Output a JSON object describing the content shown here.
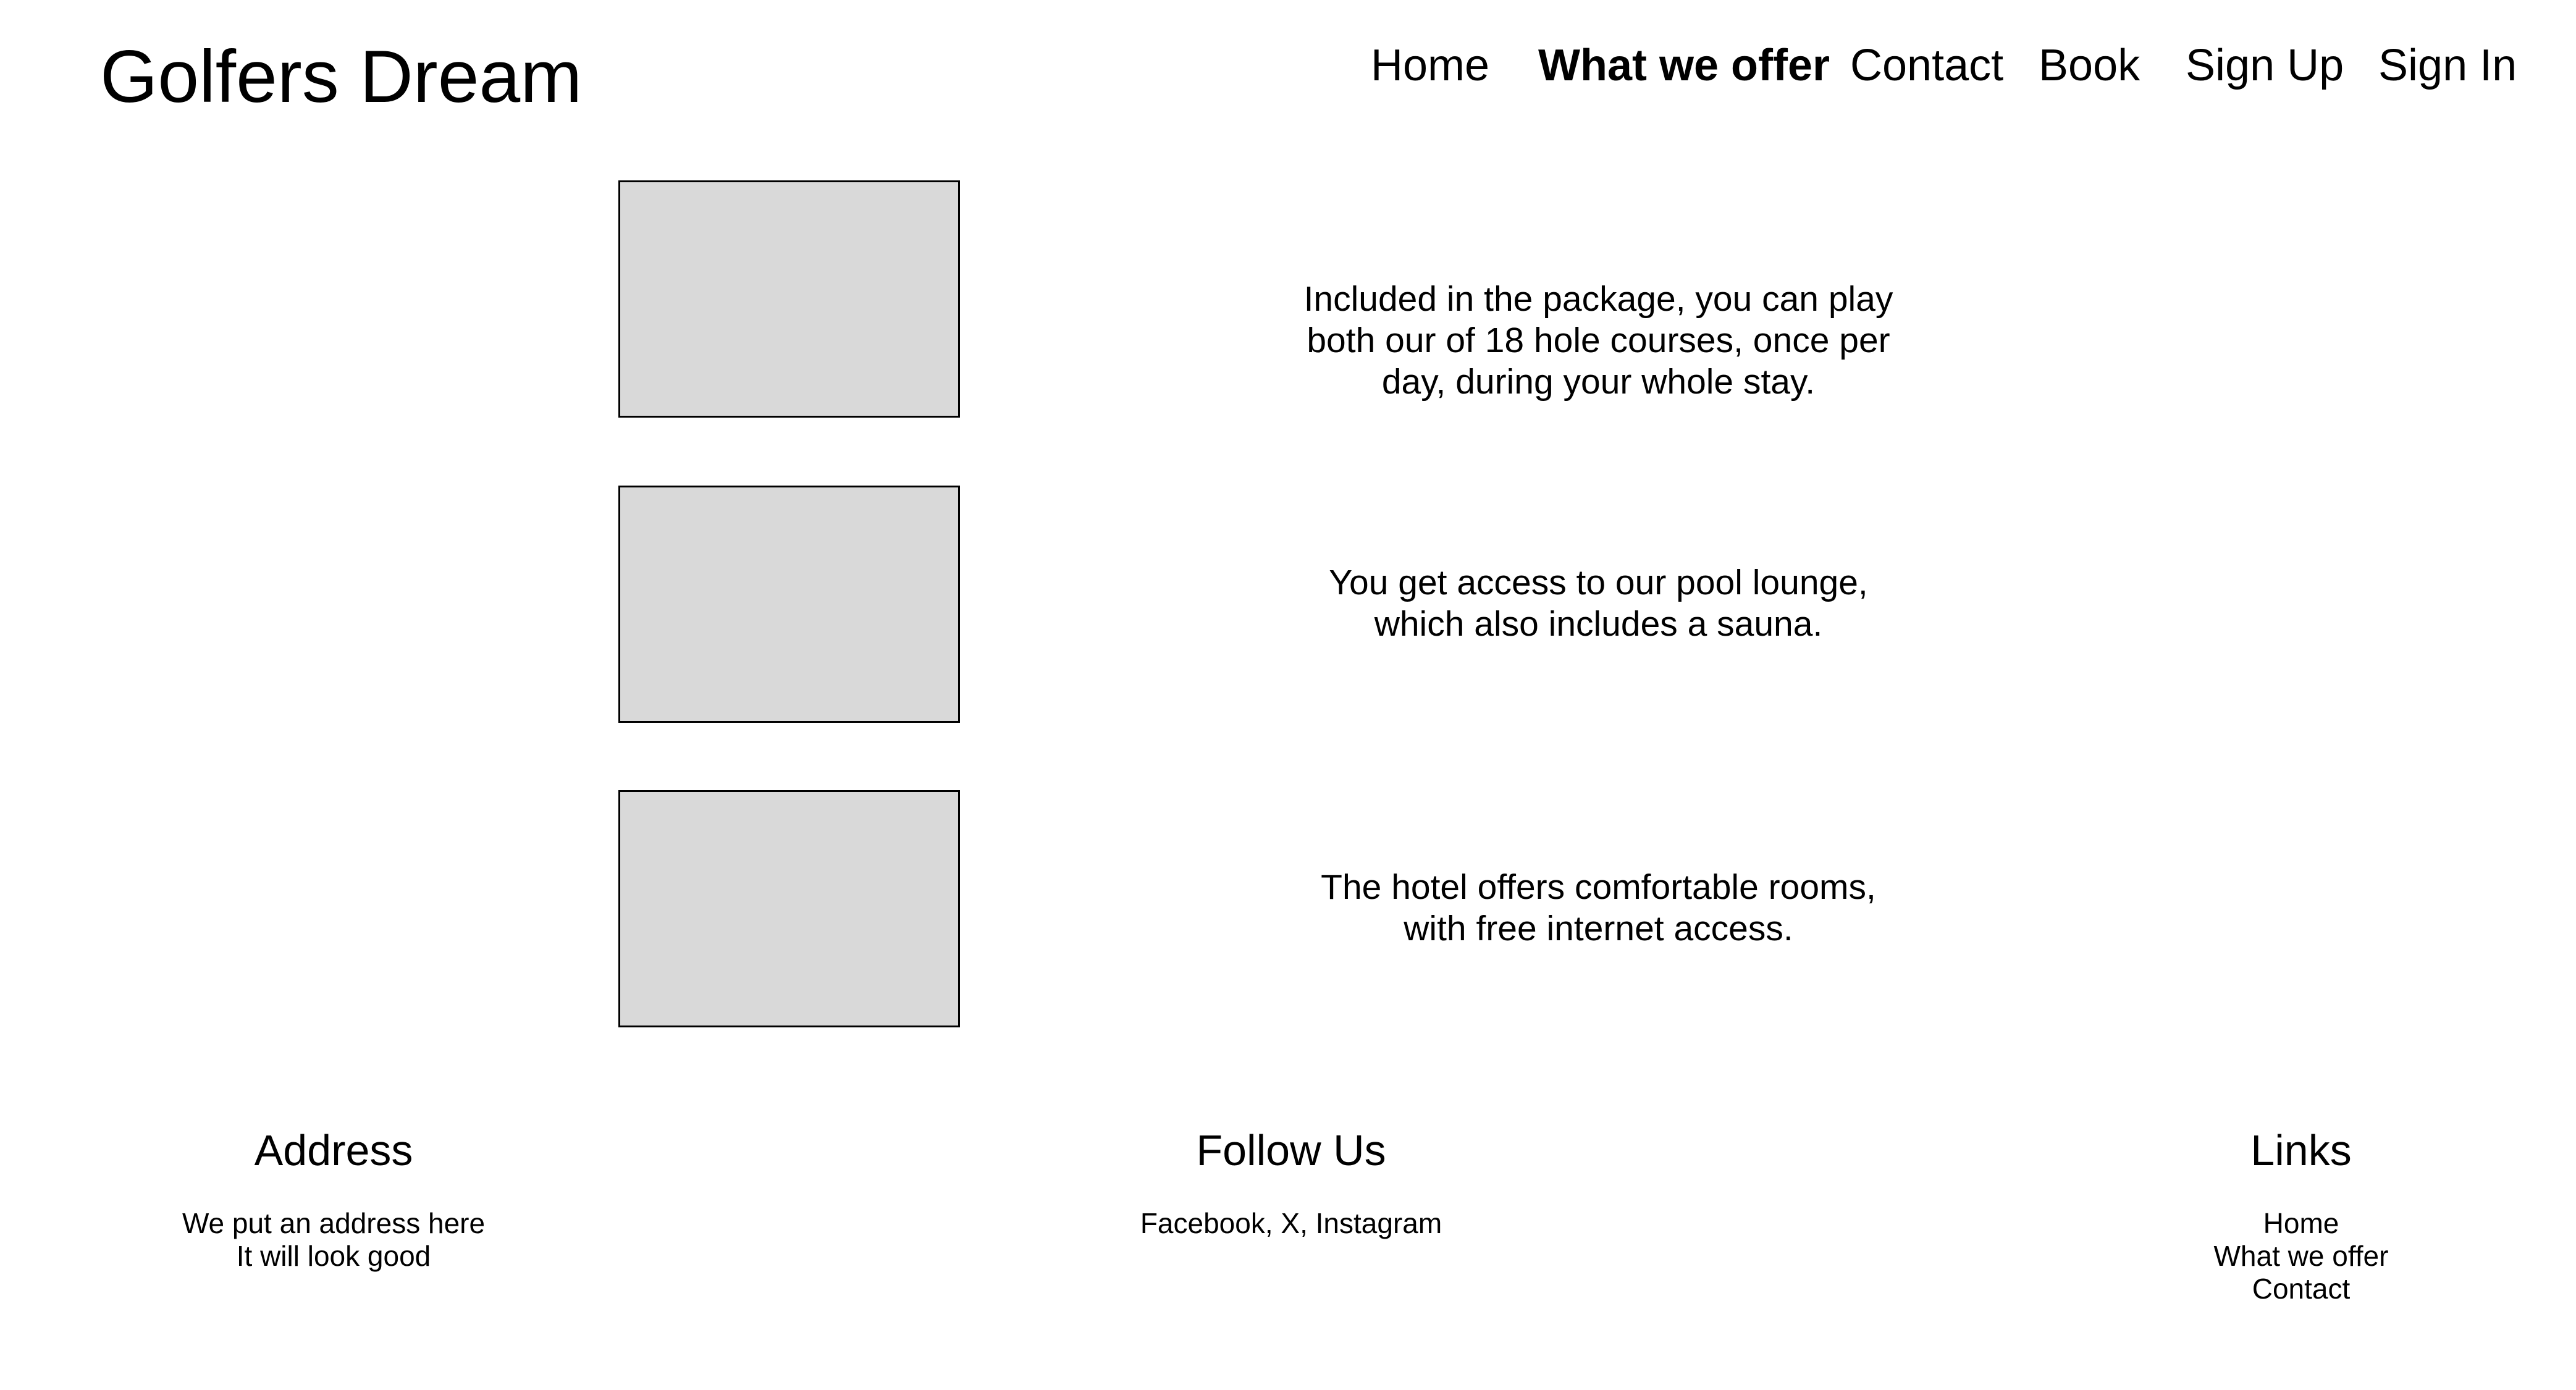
{
  "header": {
    "brand": "Golfers Dream",
    "nav": [
      {
        "label": "Home",
        "active": false
      },
      {
        "label": "What we offer",
        "active": true
      },
      {
        "label": "Contact",
        "active": false
      },
      {
        "label": "Book",
        "active": false
      },
      {
        "label": "Sign Up",
        "active": false
      },
      {
        "label": "Sign In",
        "active": false
      }
    ]
  },
  "offers": [
    {
      "text": "Included in the package, you can play\nboth our of 18 hole courses, once per\nday, during your whole stay."
    },
    {
      "text": "You get access to our pool lounge,\nwhich also includes a sauna."
    },
    {
      "text": "The hotel offers comfortable rooms,\nwith free internet access."
    }
  ],
  "footer": {
    "address": {
      "title": "Address",
      "body": "We put an address here\nIt will look good"
    },
    "follow": {
      "title": "Follow Us",
      "body": "Facebook, X, Instagram"
    },
    "links": {
      "title": "Links",
      "items": [
        "Home",
        "What we offer",
        "Contact"
      ]
    }
  },
  "colors": {
    "background": "#ffffff",
    "text": "#000000",
    "placeholder_fill": "#d9d9d9",
    "placeholder_border": "#000000"
  }
}
